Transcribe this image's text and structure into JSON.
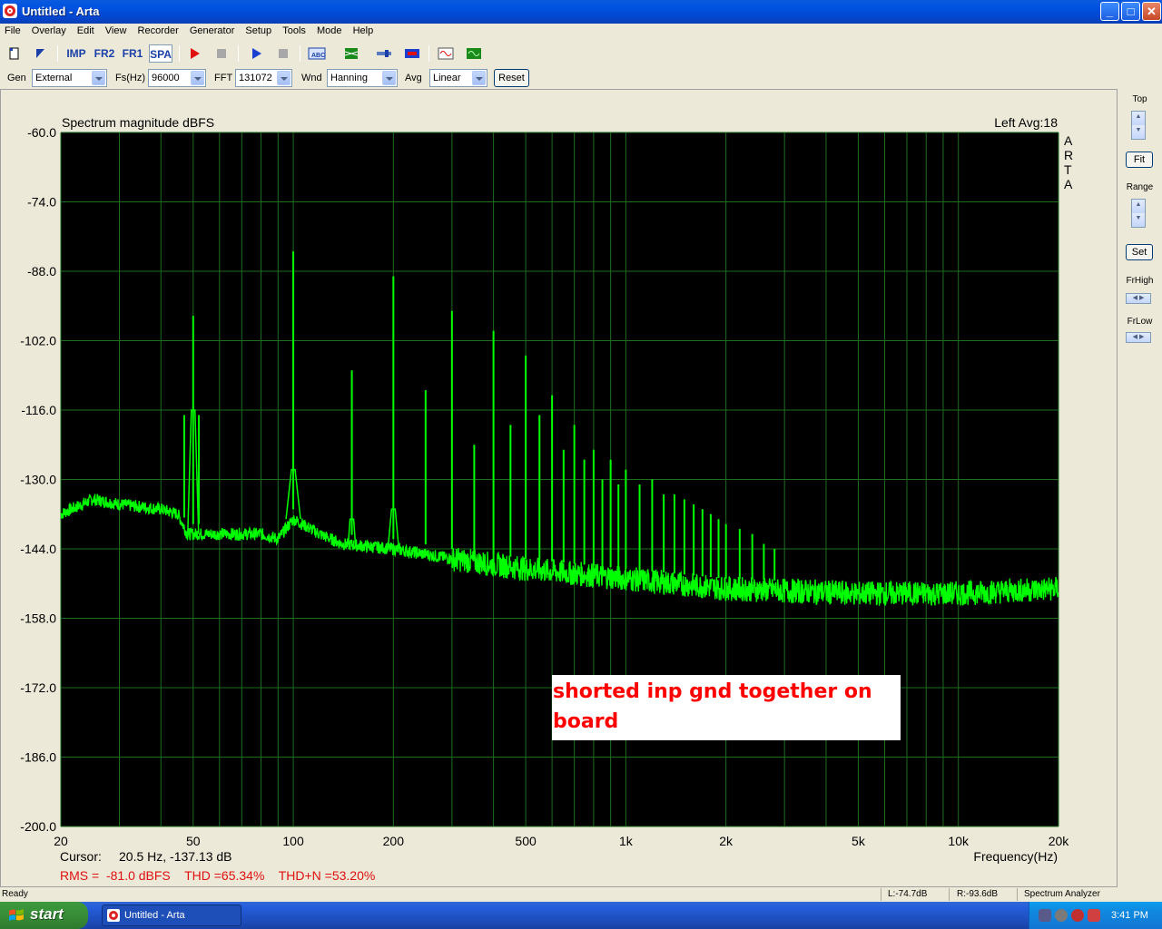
{
  "window": {
    "title": "Untitled - Arta",
    "minimize": "_",
    "maximize": "□",
    "close": "✕"
  },
  "menu": [
    "File",
    "Overlay",
    "Edit",
    "View",
    "Recorder",
    "Generator",
    "Setup",
    "Tools",
    "Mode",
    "Help"
  ],
  "toolbar": {
    "imp": "IMP",
    "fr2": "FR2",
    "fr1": "FR1",
    "spa": "SPA"
  },
  "settings": {
    "gen_label": "Gen",
    "gen_value": "External",
    "fs_label": "Fs(Hz)",
    "fs_value": "96000",
    "fft_label": "FFT",
    "fft_value": "131072",
    "wnd_label": "Wnd",
    "wnd_value": "Hanning",
    "avg_label": "Avg",
    "avg_value": "Linear",
    "reset_label": "Reset"
  },
  "right_panel": {
    "top_label": "Top",
    "fit_label": "Fit",
    "range_label": "Range",
    "set_label": "Set",
    "frhigh_label": "FrHigh",
    "frlow_label": "FrLow"
  },
  "plot": {
    "title": "Spectrum magnitude dBFS",
    "channel_avg": "Left  Avg:18",
    "watermark": [
      "A",
      "R",
      "T",
      "A"
    ],
    "cursor_label": "Cursor:",
    "cursor_value": "20.5 Hz, -137.13 dB",
    "stats": "RMS =  -81.0 dBFS    THD =65.34%    THD+N =53.20%",
    "annotation": "shorted inp gnd together on board",
    "xlabel": "Frequency(Hz)"
  },
  "chart_data": {
    "type": "line",
    "title": "Spectrum magnitude dBFS",
    "xlabel": "Frequency(Hz)",
    "ylabel": "",
    "xscale": "log",
    "xlim": [
      20,
      20000
    ],
    "ylim": [
      -200,
      -60
    ],
    "yticks": [
      "-60.0",
      "-74.0",
      "-88.0",
      "-102.0",
      "-116.0",
      "-130.0",
      "-144.0",
      "-158.0",
      "-172.0",
      "-186.0",
      "-200.0"
    ],
    "xticks": [
      {
        "v": 20,
        "t": "20"
      },
      {
        "v": 50,
        "t": "50"
      },
      {
        "v": 100,
        "t": "100"
      },
      {
        "v": 200,
        "t": "200"
      },
      {
        "v": 500,
        "t": "500"
      },
      {
        "v": 1000,
        "t": "1k"
      },
      {
        "v": 2000,
        "t": "2k"
      },
      {
        "v": 5000,
        "t": "5k"
      },
      {
        "v": 10000,
        "t": "10k"
      },
      {
        "v": 20000,
        "t": "20k"
      }
    ],
    "grid": true,
    "series_color": "#00FF00",
    "noise_floor": [
      [
        20,
        -137
      ],
      [
        25,
        -134
      ],
      [
        30,
        -135
      ],
      [
        40,
        -136
      ],
      [
        45,
        -137
      ],
      [
        48,
        -141
      ],
      [
        60,
        -141
      ],
      [
        80,
        -141
      ],
      [
        90,
        -142
      ],
      [
        100,
        -138
      ],
      [
        120,
        -141
      ],
      [
        140,
        -143
      ],
      [
        200,
        -144
      ],
      [
        300,
        -146
      ],
      [
        500,
        -148
      ],
      [
        1000,
        -150
      ],
      [
        2000,
        -152
      ],
      [
        5000,
        -153
      ],
      [
        10000,
        -153
      ],
      [
        20000,
        -152
      ]
    ],
    "peaks": [
      {
        "f": 47,
        "db": -117
      },
      {
        "f": 50,
        "db": -97
      },
      {
        "f": 52,
        "db": -117
      },
      {
        "f": 100,
        "db": -84
      },
      {
        "f": 150,
        "db": -108
      },
      {
        "f": 200,
        "db": -89
      },
      {
        "f": 250,
        "db": -112
      },
      {
        "f": 300,
        "db": -96
      },
      {
        "f": 350,
        "db": -123
      },
      {
        "f": 400,
        "db": -100
      },
      {
        "f": 450,
        "db": -119
      },
      {
        "f": 500,
        "db": -105
      },
      {
        "f": 550,
        "db": -117
      },
      {
        "f": 600,
        "db": -113
      },
      {
        "f": 650,
        "db": -124
      },
      {
        "f": 700,
        "db": -119
      },
      {
        "f": 750,
        "db": -126
      },
      {
        "f": 800,
        "db": -124
      },
      {
        "f": 850,
        "db": -130
      },
      {
        "f": 900,
        "db": -126
      },
      {
        "f": 950,
        "db": -131
      },
      {
        "f": 1000,
        "db": -128
      },
      {
        "f": 1100,
        "db": -131
      },
      {
        "f": 1200,
        "db": -130
      },
      {
        "f": 1300,
        "db": -133
      },
      {
        "f": 1400,
        "db": -133
      },
      {
        "f": 1500,
        "db": -134
      },
      {
        "f": 1600,
        "db": -135
      },
      {
        "f": 1700,
        "db": -136
      },
      {
        "f": 1800,
        "db": -137
      },
      {
        "f": 1900,
        "db": -138
      },
      {
        "f": 2000,
        "db": -139
      },
      {
        "f": 2200,
        "db": -140
      },
      {
        "f": 2400,
        "db": -141
      },
      {
        "f": 2600,
        "db": -143
      },
      {
        "f": 2800,
        "db": -144
      }
    ]
  },
  "status": {
    "ready": "Ready",
    "left": "L:-74.7dB",
    "right": "R:-93.6dB",
    "mode": "Spectrum Analyzer"
  },
  "taskbar": {
    "start": "start",
    "task": "Untitled - Arta",
    "clock": "3:41 PM"
  }
}
